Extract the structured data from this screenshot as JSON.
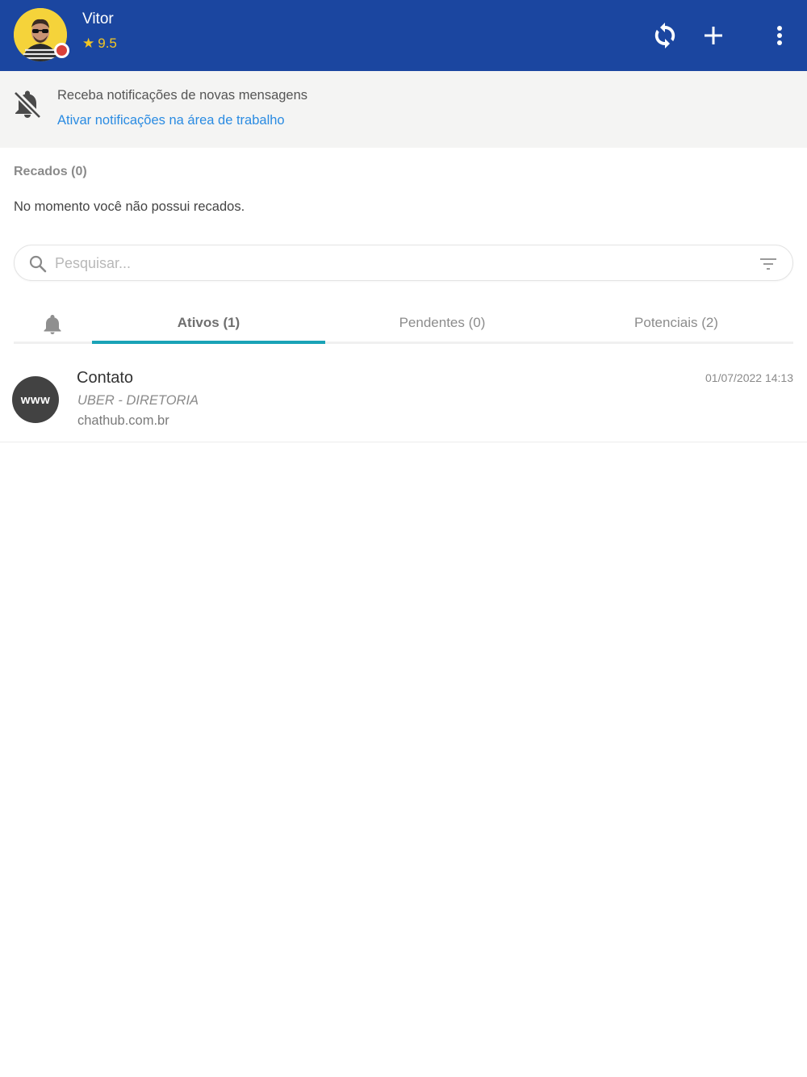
{
  "header": {
    "user_name": "Vitor",
    "rating_star": "★",
    "rating": "9.5",
    "status_color": "#d9413a",
    "background": "#1b46a0",
    "icons": [
      "refresh-icon",
      "plus-icon",
      "more-vertical-icon"
    ]
  },
  "notification": {
    "title": "Receba notificações de novas mensagens",
    "link": "Ativar notificações na área de trabalho",
    "icon": "bell-off-icon"
  },
  "recados": {
    "title": "Recados (0)",
    "empty_text": "No momento você não possui recados."
  },
  "search": {
    "placeholder": "Pesquisar...",
    "value": "",
    "icons": [
      "search-icon",
      "filter-icon"
    ]
  },
  "tabs": {
    "items": [
      {
        "label": "Ativos (1)",
        "active": true
      },
      {
        "label": "Pendentes (0)",
        "active": false
      },
      {
        "label": "Potenciais (2)",
        "active": false
      }
    ],
    "accent": "#1aa3b7"
  },
  "conversations": [
    {
      "avatar_text": "www",
      "name": "Contato",
      "subtitle": "UBER - DIRETORIA",
      "site": "chathub.com.br",
      "time": "01/07/2022 14:13"
    }
  ]
}
